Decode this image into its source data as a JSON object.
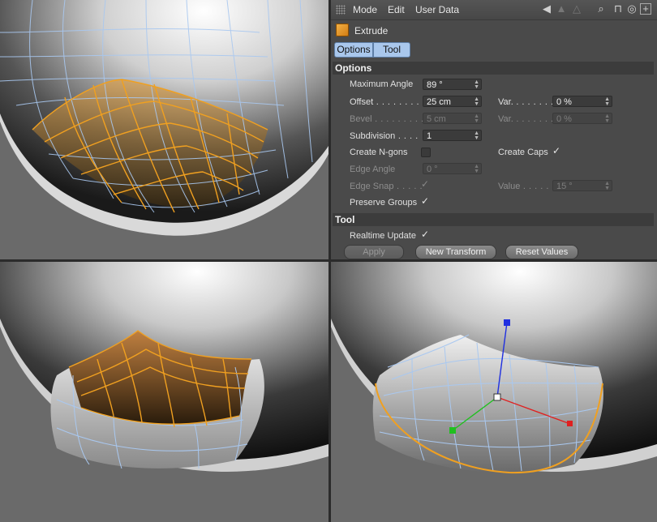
{
  "menubar": {
    "items": [
      "Mode",
      "Edit",
      "User Data"
    ]
  },
  "object": {
    "title": "Extrude",
    "icon": "extrude-cube-icon"
  },
  "tabs": [
    "Options",
    "Tool"
  ],
  "sections": {
    "options": "Options",
    "tool": "Tool"
  },
  "options": {
    "max_angle": {
      "label": "Maximum Angle",
      "value": "89 °"
    },
    "offset": {
      "label": "Offset",
      "value": "25 cm"
    },
    "offset_var": {
      "label": "Var.",
      "value": "0 %"
    },
    "bevel": {
      "label": "Bevel",
      "value": "5 cm"
    },
    "bevel_var": {
      "label": "Var.",
      "value": "0 %"
    },
    "subdivision": {
      "label": "Subdivision",
      "value": "1"
    },
    "create_ngons": {
      "label": "Create N-gons",
      "checked": false
    },
    "create_caps": {
      "label": "Create Caps",
      "checked": true
    },
    "edge_angle": {
      "label": "Edge Angle",
      "value": "0 °"
    },
    "edge_snap": {
      "label": "Edge Snap",
      "checked": true
    },
    "edge_snap_value": {
      "label": "Value",
      "value": "15 °"
    },
    "preserve_groups": {
      "label": "Preserve Groups",
      "checked": true
    }
  },
  "tool": {
    "realtime_update": {
      "label": "Realtime Update",
      "checked": true
    },
    "buttons": {
      "apply": "Apply",
      "new_transform": "New Transform",
      "reset_values": "Reset Values"
    }
  },
  "colors": {
    "selection": "#f0a020",
    "wireframe": "#a9c8f0",
    "axis_x": "#e02020",
    "axis_y": "#20c020",
    "axis_z": "#2030e0",
    "tab_active": "#a9c7ec"
  },
  "check_glyph": "✓"
}
